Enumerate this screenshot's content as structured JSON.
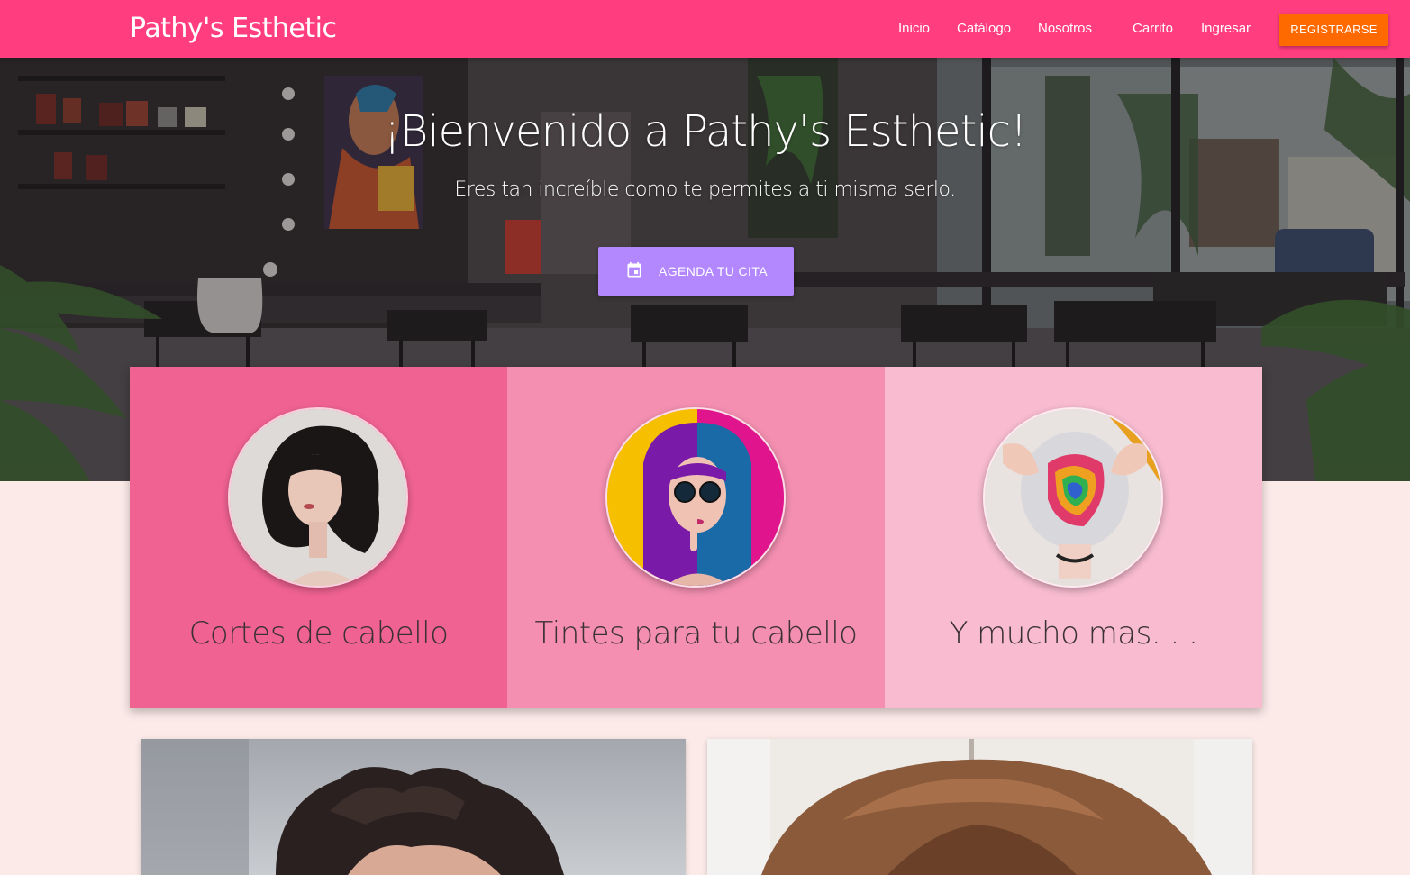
{
  "navbar": {
    "brand": "Pathy's Esthetic",
    "links": [
      "Inicio",
      "Catálogo",
      "Nosotros",
      "Carrito",
      "Ingresar"
    ],
    "register_label": "REGISTRARSE"
  },
  "hero": {
    "title": "¡Bienvenido a Pathy's Esthetic!",
    "subtitle": "Eres tan increíble como te permites a ti misma serlo.",
    "cta_label": "AGENDA TU CITA",
    "cta_icon": "calendar-event-icon"
  },
  "services": [
    {
      "label": "Cortes de cabello",
      "color": "#f06292"
    },
    {
      "label": "Tintes para tu cabello",
      "color": "#f48fb1"
    },
    {
      "label": "Y mucho mas. . .",
      "color": "#f8bbd0"
    }
  ],
  "colors": {
    "navbar": "#ff3d7f",
    "register_button": "#ff6a00",
    "cta_button": "#b388ff",
    "page_background": "#fbeae8"
  }
}
